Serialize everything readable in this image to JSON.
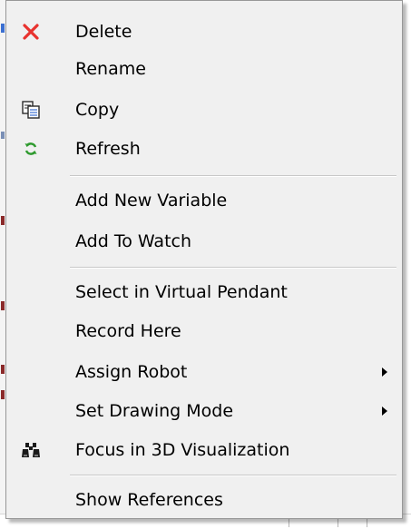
{
  "context_menu": {
    "items": [
      {
        "label": "Delete",
        "icon": "delete-x-icon",
        "submenu": false
      },
      {
        "label": "Rename",
        "icon": null,
        "submenu": false
      },
      {
        "label": "Copy",
        "icon": "copy-icon",
        "submenu": false
      },
      {
        "label": "Refresh",
        "icon": "refresh-icon",
        "submenu": false
      },
      {
        "label": "Add New Variable",
        "icon": null,
        "submenu": false
      },
      {
        "label": "Add To Watch",
        "icon": null,
        "submenu": false
      },
      {
        "label": "Select in Virtual Pendant",
        "icon": null,
        "submenu": false
      },
      {
        "label": "Record Here",
        "icon": null,
        "submenu": false
      },
      {
        "label": "Assign Robot",
        "icon": null,
        "submenu": true
      },
      {
        "label": "Set Drawing Mode",
        "icon": null,
        "submenu": true
      },
      {
        "label": "Focus in 3D Visualization",
        "icon": "binoculars-icon",
        "submenu": false
      },
      {
        "label": "Show References",
        "icon": null,
        "submenu": false
      }
    ],
    "colors": {
      "menu_background": "#f0f0f0",
      "border": "#979797",
      "delete_icon": "#e8322e",
      "refresh_icon": "#2e9a2e",
      "separator": "#c8c8c8"
    }
  }
}
